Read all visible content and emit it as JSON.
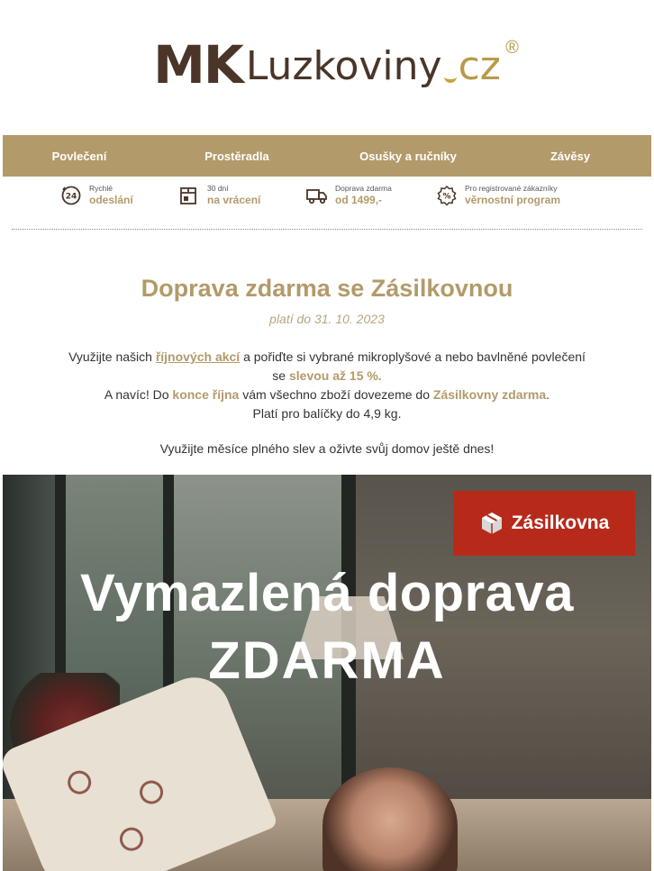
{
  "logo": {
    "mk": "MK",
    "name": "Luzkoviny",
    "tld": "cz",
    "registered": "®"
  },
  "nav": {
    "items": [
      {
        "label": "Povlečení"
      },
      {
        "label": "Prostěradla"
      },
      {
        "label": "Osušky a ručníky"
      },
      {
        "label": "Závěsy"
      }
    ]
  },
  "benefits": [
    {
      "icon": "clock-24-icon",
      "small": "Rychlé",
      "big": "odeslání"
    },
    {
      "icon": "return-box-icon",
      "small": "30 dní",
      "big": "na vrácení"
    },
    {
      "icon": "truck-icon",
      "small": "Doprava zdarma",
      "big": "od 1499,-"
    },
    {
      "icon": "percent-badge-icon",
      "small": "Pro registrované zákazníky",
      "big": "věrnostní program"
    }
  ],
  "headline": "Doprava zdarma se Zásilkovnou",
  "validity": "platí do 31. 10. 2023",
  "body": {
    "line1_a": "Využijte našich ",
    "line1_link": "říjnových akcí",
    "line1_b": " a pořiďte si vybrané mikroplyšové a nebo bavlněné povlečení",
    "line2_a": "se ",
    "line2_hl": "slevou až 15 %.",
    "line3_a": "A navíc! Do ",
    "line3_hl1": "konce října",
    "line3_b": " vám všechno zboží dovezeme do ",
    "line3_hl2": "Zásilkovny zdarma",
    "line3_c": ".",
    "line4": "Platí pro balíčky do 4,9 kg."
  },
  "cta_line": "Využijte měsíce plného slev a oživte svůj domov ještě dnes!",
  "banner": {
    "brand": "Zásilkovna",
    "title_line1": "Vymazlená doprava",
    "title_line2": "ZDARMA"
  },
  "colors": {
    "accent": "#b39a6a",
    "brand_dark": "#4a3528",
    "zasilkovna_red": "#b72a1a"
  }
}
